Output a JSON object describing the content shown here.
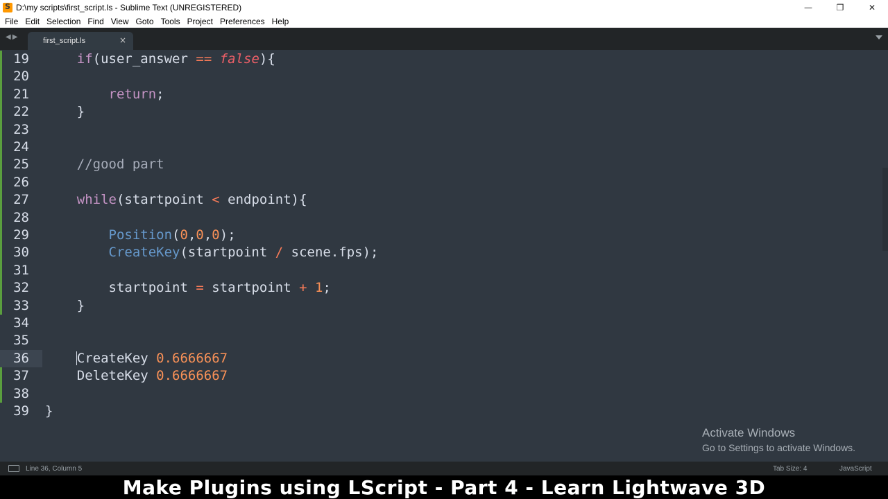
{
  "window": {
    "title": "D:\\my scripts\\first_script.ls - Sublime Text (UNREGISTERED)",
    "controls": {
      "minimize": "—",
      "restore": "❐",
      "close": "✕"
    }
  },
  "menu": [
    "File",
    "Edit",
    "Selection",
    "Find",
    "View",
    "Goto",
    "Tools",
    "Project",
    "Preferences",
    "Help"
  ],
  "tabs": {
    "nav_glyph": "◀▶",
    "active": {
      "label": "first_script.ls",
      "close": "×"
    }
  },
  "editor": {
    "current_line": 36,
    "lines": [
      {
        "n": "19",
        "tokens": [
          [
            "",
            "    "
          ],
          [
            "kw",
            "if"
          ],
          [
            "punc",
            "(user_answer "
          ],
          [
            "op",
            "=="
          ],
          [
            "punc",
            " "
          ],
          [
            "lit",
            "false"
          ],
          [
            "punc",
            "){"
          ]
        ]
      },
      {
        "n": "20",
        "tokens": []
      },
      {
        "n": "21",
        "tokens": [
          [
            "",
            "        "
          ],
          [
            "kw",
            "return"
          ],
          [
            "punc",
            ";"
          ]
        ]
      },
      {
        "n": "22",
        "tokens": [
          [
            "",
            "    "
          ],
          [
            "punc",
            "}"
          ]
        ]
      },
      {
        "n": "23",
        "tokens": []
      },
      {
        "n": "24",
        "tokens": []
      },
      {
        "n": "25",
        "tokens": [
          [
            "",
            "    "
          ],
          [
            "cm",
            "//good part"
          ]
        ]
      },
      {
        "n": "26",
        "tokens": []
      },
      {
        "n": "27",
        "tokens": [
          [
            "",
            "    "
          ],
          [
            "kw",
            "while"
          ],
          [
            "punc",
            "(startpoint "
          ],
          [
            "op",
            "<"
          ],
          [
            "punc",
            " endpoint){"
          ]
        ]
      },
      {
        "n": "28",
        "tokens": []
      },
      {
        "n": "29",
        "tokens": [
          [
            "",
            "        "
          ],
          [
            "fn",
            "Position"
          ],
          [
            "punc",
            "("
          ],
          [
            "num",
            "0"
          ],
          [
            "punc",
            ","
          ],
          [
            "num",
            "0"
          ],
          [
            "punc",
            ","
          ],
          [
            "num",
            "0"
          ],
          [
            "punc",
            ");"
          ]
        ]
      },
      {
        "n": "30",
        "tokens": [
          [
            "",
            "        "
          ],
          [
            "fn",
            "CreateKey"
          ],
          [
            "punc",
            "(startpoint "
          ],
          [
            "op",
            "/"
          ],
          [
            "punc",
            " scene.fps);"
          ]
        ]
      },
      {
        "n": "31",
        "tokens": []
      },
      {
        "n": "32",
        "tokens": [
          [
            "",
            "        "
          ],
          [
            "punc",
            "startpoint "
          ],
          [
            "op",
            "="
          ],
          [
            "punc",
            " startpoint "
          ],
          [
            "op",
            "+"
          ],
          [
            "punc",
            " "
          ],
          [
            "num",
            "1"
          ],
          [
            "punc",
            ";"
          ]
        ]
      },
      {
        "n": "33",
        "tokens": [
          [
            "",
            "    "
          ],
          [
            "punc",
            "}"
          ]
        ]
      },
      {
        "n": "34",
        "tokens": []
      },
      {
        "n": "35",
        "tokens": []
      },
      {
        "n": "36",
        "tokens": [
          [
            "",
            "    "
          ],
          [
            "punc",
            "CreateKey "
          ],
          [
            "num",
            "0.6666667"
          ]
        ]
      },
      {
        "n": "37",
        "tokens": [
          [
            "",
            "    "
          ],
          [
            "punc",
            "DeleteKey "
          ],
          [
            "num",
            "0.6666667"
          ]
        ]
      },
      {
        "n": "38",
        "tokens": []
      },
      {
        "n": "39",
        "tokens": [
          [
            "punc",
            "}"
          ]
        ]
      }
    ]
  },
  "watermark": {
    "line1": "Activate Windows",
    "line2": "Go to Settings to activate Windows."
  },
  "status": {
    "position": "Line 36, Column 5",
    "tab_size": "Tab Size: 4",
    "syntax": "JavaScript"
  },
  "caption": "Make Plugins using LScript - Part 4 - Learn Lightwave 3D",
  "colors": {
    "editor_bg": "#303841",
    "keyword": "#c594c5",
    "number": "#f99157",
    "function": "#6699cc",
    "operator": "#f97b58",
    "literal": "#ec5f67",
    "gutter_modified": "#5a9e3e"
  }
}
